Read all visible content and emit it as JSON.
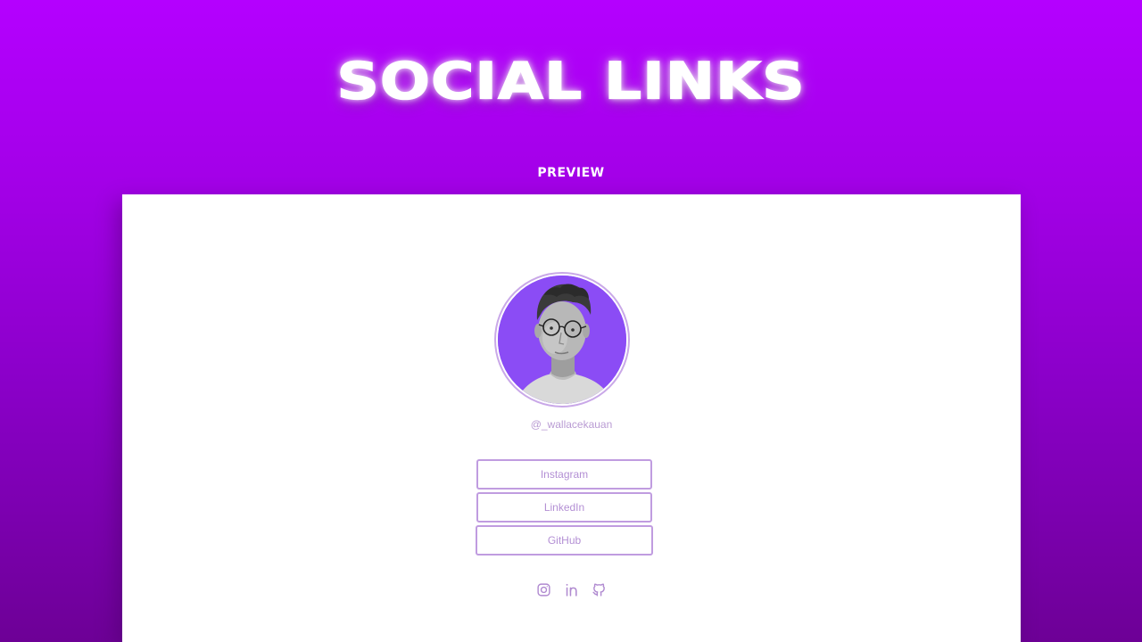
{
  "header": {
    "title": "SOCIAL LINKS",
    "preview_label": "PREVIEW"
  },
  "profile": {
    "handle": "@_wallacekauan",
    "avatar_bg": "#8b4cf5"
  },
  "links": [
    {
      "label": "Instagram"
    },
    {
      "label": "LinkedIn"
    },
    {
      "label": "GitHub"
    }
  ],
  "social_icons": [
    "instagram-icon",
    "linkedin-icon",
    "github-icon"
  ],
  "colors": {
    "gradient_top": "#b400ff",
    "gradient_bottom": "#6d0096",
    "accent": "#c09ce0",
    "card": "#ffffff"
  }
}
